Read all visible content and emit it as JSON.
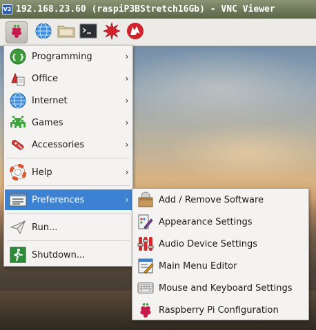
{
  "window": {
    "title": "192.168.23.60 (raspiP3BStretch16Gb) - VNC Viewer",
    "icon_label": "V2"
  },
  "panel": {
    "items": [
      {
        "name": "menu-button",
        "icon": "raspberry-icon"
      },
      {
        "name": "web-browser-launcher",
        "icon": "globe-icon"
      },
      {
        "name": "file-manager-launcher",
        "icon": "folder-icon"
      },
      {
        "name": "terminal-launcher",
        "icon": "terminal-icon"
      },
      {
        "name": "mathematica-launcher",
        "icon": "spiky-star-icon"
      },
      {
        "name": "wolfram-launcher",
        "icon": "wolf-icon"
      }
    ]
  },
  "menu": {
    "items": [
      {
        "label": "Programming",
        "icon": "programming-icon",
        "has_submenu": true
      },
      {
        "label": "Office",
        "icon": "office-icon",
        "has_submenu": true
      },
      {
        "label": "Internet",
        "icon": "globe-icon",
        "has_submenu": true
      },
      {
        "label": "Games",
        "icon": "games-icon",
        "has_submenu": true
      },
      {
        "label": "Accessories",
        "icon": "accessories-icon",
        "has_submenu": true
      },
      {
        "label": "Help",
        "icon": "lifebuoy-icon",
        "has_submenu": true
      },
      {
        "label": "Preferences",
        "icon": "preferences-icon",
        "has_submenu": true,
        "active": true
      },
      {
        "label": "Run...",
        "icon": "paper-plane-icon",
        "has_submenu": false
      },
      {
        "label": "Shutdown...",
        "icon": "exit-icon",
        "has_submenu": false
      }
    ],
    "arrow_glyph": "›",
    "active_color": "#3d82d2"
  },
  "submenu": {
    "items": [
      {
        "label": "Add / Remove Software",
        "icon": "package-icon"
      },
      {
        "label": "Appearance Settings",
        "icon": "appearance-icon"
      },
      {
        "label": "Audio Device Settings",
        "icon": "audio-mixer-icon"
      },
      {
        "label": "Main Menu Editor",
        "icon": "menu-editor-icon"
      },
      {
        "label": "Mouse and Keyboard Settings",
        "icon": "keyboard-icon"
      },
      {
        "label": "Raspberry Pi Configuration",
        "icon": "raspberry-icon"
      }
    ]
  }
}
